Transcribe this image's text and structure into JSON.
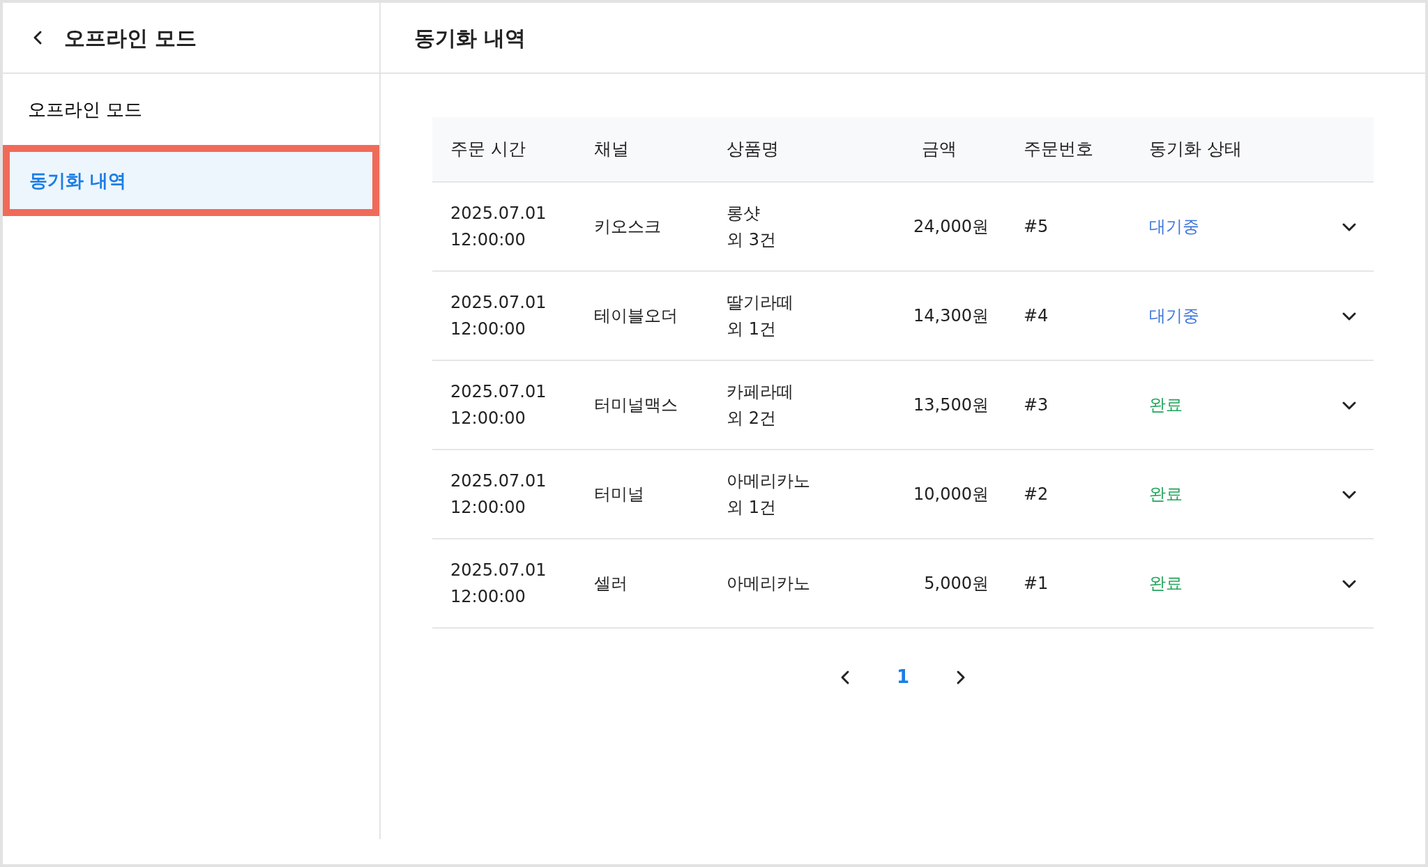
{
  "sidebar": {
    "title": "오프라인 모드",
    "items": [
      {
        "label": "오프라인 모드",
        "selected": false
      },
      {
        "label": "동기화 내역",
        "selected": true
      }
    ]
  },
  "main": {
    "title": "동기화 내역"
  },
  "table": {
    "columns": [
      "주문 시간",
      "채널",
      "상품명",
      "금액",
      "주문번호",
      "동기화 상태"
    ],
    "rows": [
      {
        "date": "2025.07.01",
        "time": "12:00:00",
        "channel": "키오스크",
        "product": "롱샷",
        "extra": "외 3건",
        "amount": "24,000원",
        "order": "#5",
        "status": "대기중",
        "color": "#3b74d9"
      },
      {
        "date": "2025.07.01",
        "time": "12:00:00",
        "channel": "테이블오더",
        "product": "딸기라떼",
        "extra": "외 1건",
        "amount": "14,300원",
        "order": "#4",
        "status": "대기중",
        "color": "#3b74d9"
      },
      {
        "date": "2025.07.01",
        "time": "12:00:00",
        "channel": "터미널맥스",
        "product": "카페라떼",
        "extra": "외 2건",
        "amount": "13,500원",
        "order": "#3",
        "status": "완료",
        "color": "#22a55b"
      },
      {
        "date": "2025.07.01",
        "time": "12:00:00",
        "channel": "터미널",
        "product": "아메리카노",
        "extra": "외 1건",
        "amount": "10,000원",
        "order": "#2",
        "status": "완료",
        "color": "#22a55b"
      },
      {
        "date": "2025.07.01",
        "time": "12:00:00",
        "channel": "셀러",
        "product": "아메리카노",
        "amount": "5,000원",
        "order": "#1",
        "status": "완료",
        "color": "#22a55b"
      }
    ]
  },
  "pagination": {
    "pages": [
      {
        "label": "1",
        "selected": true
      }
    ]
  }
}
